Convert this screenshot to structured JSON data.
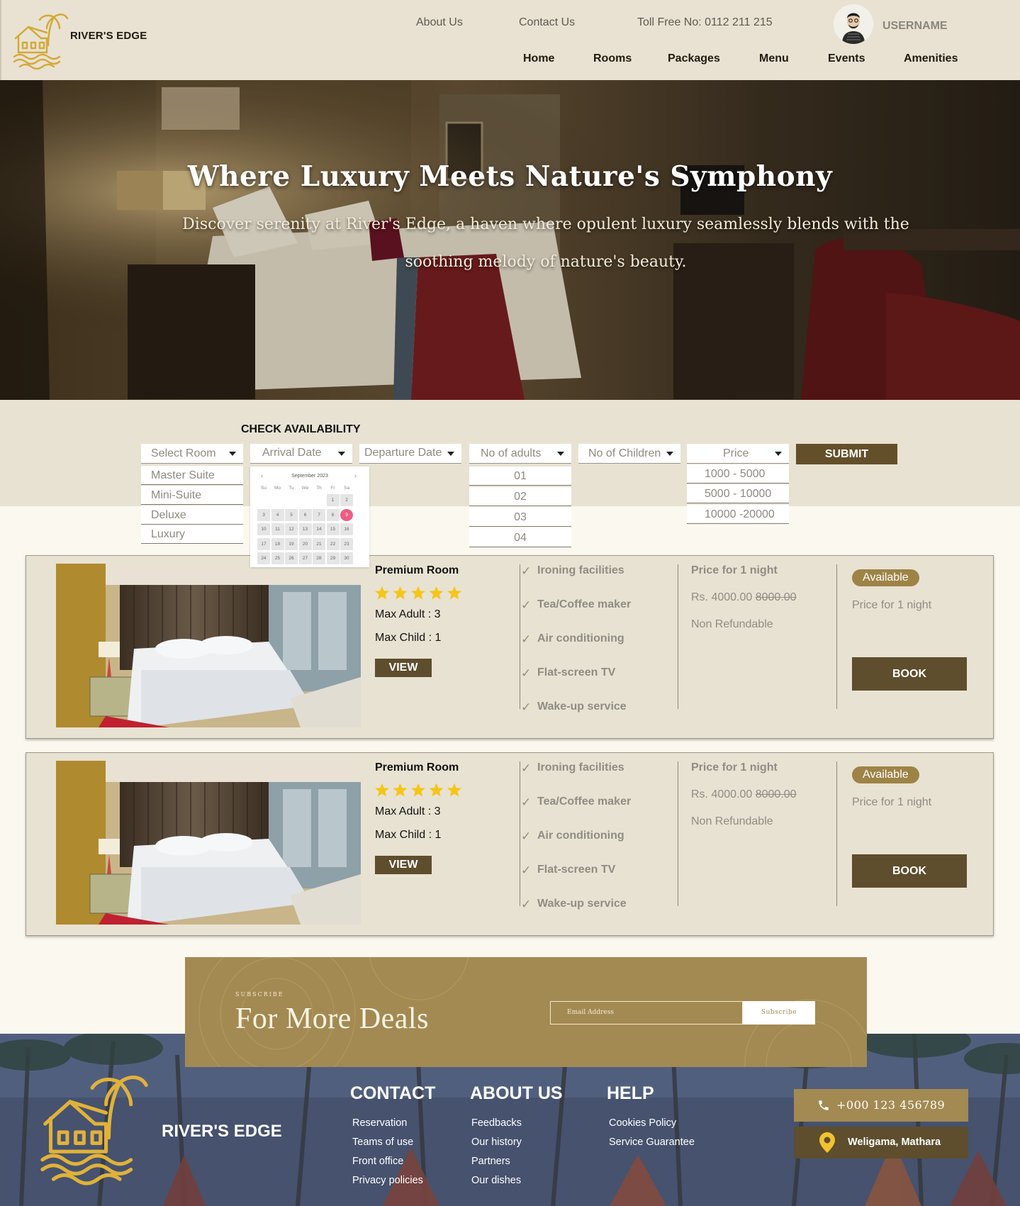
{
  "brand": {
    "name": "RIVER'S EDGE"
  },
  "header": {
    "top_links": [
      "About Us",
      "Contact Us",
      "Toll Free No: 0112 211 215"
    ],
    "username": "USERNAME",
    "nav": [
      "Home",
      "Rooms",
      "Packages",
      "Menu",
      "Events",
      "Amenities"
    ]
  },
  "hero": {
    "title": "Where Luxury Meets Nature's Symphony",
    "subtitle": "Discover serenity at River's Edge, a haven where opulent luxury seamlessly blends with the soothing melody of nature's beauty."
  },
  "availability": {
    "title": "CHECK AVAILABILITY",
    "select_room": {
      "placeholder": "Select Room",
      "options": [
        "Master Suite",
        "Mini-Suite",
        "Deluxe",
        "Luxury"
      ]
    },
    "arrival": {
      "placeholder": "Arrival Date"
    },
    "departure": {
      "placeholder": "Departure Date"
    },
    "adults": {
      "placeholder": "No of adults",
      "options": [
        "01",
        "02",
        "03",
        "04"
      ]
    },
    "children": {
      "placeholder": "No of Children"
    },
    "price": {
      "placeholder": "Price",
      "options": [
        "1000 - 5000",
        "5000 - 10000",
        "10000 -20000"
      ]
    },
    "submit": "SUBMIT",
    "calendar": {
      "month": "September 2023",
      "weekdays": [
        "Su",
        "Mo",
        "Tu",
        "We",
        "Th",
        "Fr",
        "Sa"
      ],
      "selected_day": 9,
      "weeks": [
        [
          "",
          "",
          "",
          "",
          "",
          "1",
          "2"
        ],
        [
          "3",
          "4",
          "5",
          "6",
          "7",
          "8",
          "9"
        ],
        [
          "10",
          "11",
          "12",
          "13",
          "14",
          "15",
          "16"
        ],
        [
          "17",
          "18",
          "19",
          "20",
          "21",
          "22",
          "23"
        ],
        [
          "24",
          "25",
          "26",
          "27",
          "28",
          "29",
          "30"
        ]
      ]
    }
  },
  "rooms": [
    {
      "title": "Premium Room",
      "stars": 5,
      "max_adult": "Max Adult : 3",
      "max_child": "Max Child : 1",
      "view": "VIEW",
      "features": [
        "Ironing facilities",
        "Tea/Coffee maker",
        "Air conditioning",
        "Flat-screen TV",
        "Wake-up service"
      ],
      "price_title": "Price for 1 night",
      "price_now": "Rs. 4000.00",
      "price_old": "8000.00",
      "refund": "Non Refundable",
      "badge": "Available",
      "price_note": "Price for 1 night",
      "book": "BOOK"
    },
    {
      "title": "Premium Room",
      "stars": 5,
      "max_adult": "Max Adult : 3",
      "max_child": "Max Child : 1",
      "view": "VIEW",
      "features": [
        "Ironing facilities",
        "Tea/Coffee maker",
        "Air conditioning",
        "Flat-screen TV",
        "Wake-up service"
      ],
      "price_title": "Price for 1 night",
      "price_now": "Rs. 4000.00",
      "price_old": "8000.00",
      "refund": "Non Refundable",
      "badge": "Available",
      "price_note": "Price for 1 night",
      "book": "BOOK"
    }
  ],
  "subscribe": {
    "kicker": "SUBSCRIBE",
    "title": "For More Deals",
    "email_placeholder": "Email Address",
    "button": "Subscribe"
  },
  "footer": {
    "brand": "RIVER'S EDGE",
    "columns": [
      {
        "title": "CONTACT",
        "links": [
          "Reservation",
          "Teams of use",
          "Front office",
          "Privacy policies"
        ]
      },
      {
        "title": "ABOUT US",
        "links": [
          "Feedbacks",
          "Our history",
          "Partners",
          "Our dishes"
        ]
      },
      {
        "title": "HELP",
        "links": [
          "Cookies Policy",
          "Service Guarantee"
        ]
      }
    ],
    "phone": "+000 123 456789",
    "location": "Weligama, Mathara"
  },
  "colors": {
    "accent": "#a38a52",
    "dark": "#5e4e2d",
    "panel": "#e8e2d2",
    "star": "#f5c518",
    "selected_day": "#ef5c84"
  },
  "icons": [
    "house-palm-logo-icon",
    "user-avatar-icon",
    "caret-down-icon",
    "star-icon",
    "check-icon",
    "phone-icon",
    "location-pin-icon"
  ]
}
